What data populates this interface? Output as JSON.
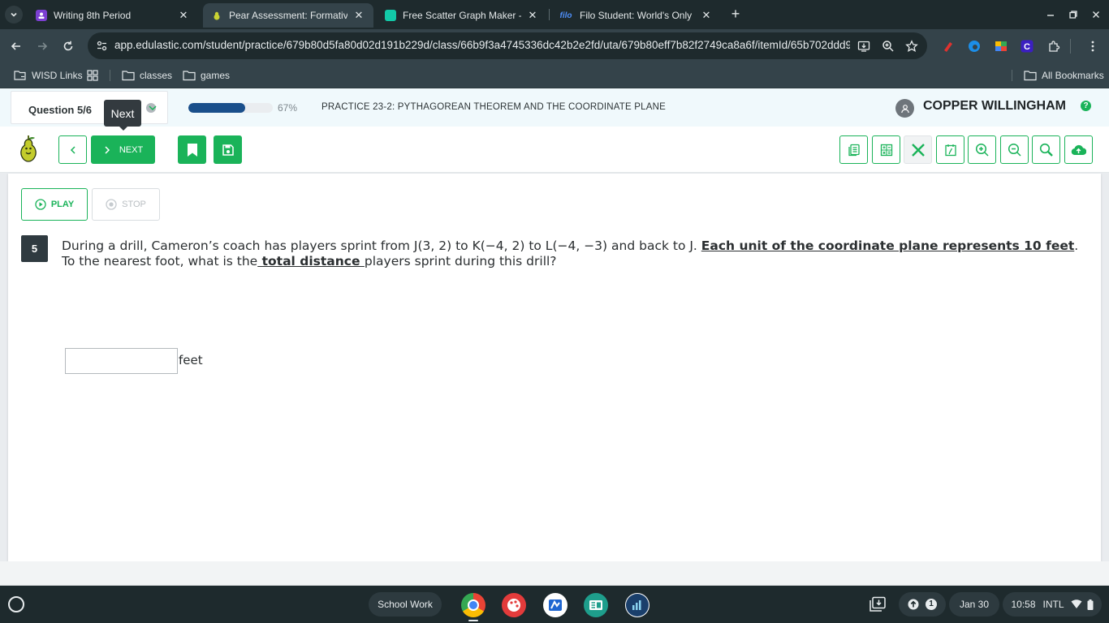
{
  "browser": {
    "tabs": [
      {
        "title": "Writing 8th Period",
        "active": false
      },
      {
        "title": "Pear Assessment: Formative a",
        "active": true
      },
      {
        "title": "Free Scatter Graph Maker - Cre",
        "active": false
      },
      {
        "title": "Filo Student: World's Only Live",
        "active": false
      }
    ],
    "url": "app.edulastic.com/student/practice/679b80d5fa80d02d191b229d/class/66b9f3a4745336dc42b2e2fd/uta/679b80eff7b82f2749ca8a6f/itemId/65b702ddd9..."
  },
  "bookmarks": {
    "wisd": "WISD Links",
    "classes": "classes",
    "games": "games",
    "all": "All Bookmarks"
  },
  "header": {
    "question_label": "Question 5/6",
    "tooltip": "Next",
    "progress_label": "67%",
    "progress_value": 0.67,
    "assignment_title": "PRACTICE 23-2: PYTHAGOREAN THEOREM AND THE COORDINATE PLANE",
    "user_name": "COPPER WILLINGHAM",
    "help_symbol": "?"
  },
  "toolbar": {
    "next_label": "NEXT"
  },
  "question": {
    "play_label": "PLAY",
    "stop_label": "STOP",
    "number": "5",
    "text_part1": "During a drill, Cameron’s coach has players sprint from J(3, 2) to K(−4, 2) to L(−4, −3) and back to J. ",
    "text_bold1": "Each unit of the coordinate plane represents 10 feet",
    "text_part2": ". To the nearest foot, what is the",
    "text_bold2": " total distance ",
    "text_part3": "players sprint during this drill?",
    "answer_value": "",
    "unit_label": "feet"
  },
  "shelf": {
    "school_work": "School Work",
    "notification_count": "1",
    "date": "Jan 30",
    "time": "10:58",
    "locale": "INTL"
  },
  "colors": {
    "accent_green": "#1ab359",
    "progress_blue": "#1a4f8b",
    "chrome_dark": "#1e2a2d",
    "chrome_toolbar": "#34434a"
  }
}
